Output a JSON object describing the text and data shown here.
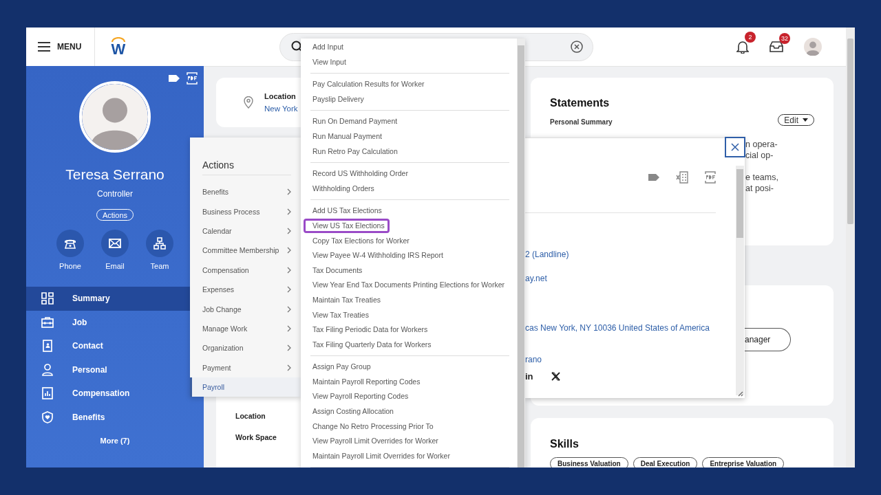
{
  "top_bar": {
    "menu_label": "MENU",
    "logo": "W",
    "notifications": {
      "count": "2"
    },
    "inbox": {
      "count": "32"
    }
  },
  "profile": {
    "name": "Teresa Serrano",
    "title": "Controller",
    "actions_button": "Actions",
    "quick_actions": [
      {
        "kind": "phone",
        "label": "Phone"
      },
      {
        "kind": "email",
        "label": "Email"
      },
      {
        "kind": "team",
        "label": "Team"
      }
    ]
  },
  "nav": {
    "items": [
      {
        "kind": "summary",
        "label": "Summary",
        "selected": true
      },
      {
        "kind": "job",
        "label": "Job",
        "selected": false
      },
      {
        "kind": "contact",
        "label": "Contact",
        "selected": false
      },
      {
        "kind": "personal",
        "label": "Personal",
        "selected": false
      },
      {
        "kind": "compensation",
        "label": "Compensation",
        "selected": false
      },
      {
        "kind": "benefits",
        "label": "Benefits",
        "selected": false
      }
    ],
    "more": "More (7)"
  },
  "location_card": {
    "label": "Location",
    "value": "New York"
  },
  "job_card": {
    "labels": [
      "Location",
      "Work Space"
    ]
  },
  "statements": {
    "title": "Statements",
    "subtitle": "Personal Summary",
    "edit_button": "Edit",
    "paragraphs": [
      [
        "n opera-",
        "cial op-"
      ],
      [
        "e teams,",
        "at posi-"
      ]
    ]
  },
  "manager_card": {
    "button": "anager"
  },
  "skills": {
    "title": "Skills",
    "chips": [
      "Business Valuation",
      "Deal Execution",
      "Entreprise Valuation"
    ]
  },
  "contact_popup": {
    "phone": "2 (Landline)",
    "email": "ay.net",
    "address": "cas New York, NY 10036 United States of America",
    "name": "rano",
    "social": [
      {
        "kind": "linkedin",
        "label": "in"
      },
      {
        "kind": "x"
      }
    ]
  },
  "actions_menu": {
    "title": "Actions",
    "items": [
      {
        "label": "Benefits",
        "selected": false
      },
      {
        "label": "Business Process",
        "selected": false
      },
      {
        "label": "Calendar",
        "selected": false
      },
      {
        "label": "Committee Membership",
        "selected": false
      },
      {
        "label": "Compensation",
        "selected": false
      },
      {
        "label": "Expenses",
        "selected": false
      },
      {
        "label": "Job Change",
        "selected": false
      },
      {
        "label": "Manage Work",
        "selected": false
      },
      {
        "label": "Organization",
        "selected": false
      },
      {
        "label": "Payment",
        "selected": false
      },
      {
        "label": "Payroll",
        "selected": true
      }
    ]
  },
  "payroll_submenu": {
    "groups": [
      [
        {
          "label": "Add Input",
          "highlighted": false
        },
        {
          "label": "View Input",
          "highlighted": false
        }
      ],
      [
        {
          "label": "Pay Calculation Results for Worker",
          "highlighted": false
        },
        {
          "label": "Payslip Delivery",
          "highlighted": false
        }
      ],
      [
        {
          "label": "Run On Demand Payment",
          "highlighted": false
        },
        {
          "label": "Run Manual Payment",
          "highlighted": false
        },
        {
          "label": "Run Retro Pay Calculation",
          "highlighted": false
        }
      ],
      [
        {
          "label": "Record US Withholding Order",
          "highlighted": false
        },
        {
          "label": "Withholding Orders",
          "highlighted": false
        }
      ],
      [
        {
          "label": "Add US Tax Elections",
          "highlighted": false
        },
        {
          "label": "View US Tax Elections",
          "highlighted": true
        },
        {
          "label": "Copy Tax Elections for Worker",
          "highlighted": false
        },
        {
          "label": "View Payee W-4 Withholding IRS Report",
          "highlighted": false
        },
        {
          "label": "Tax Documents",
          "highlighted": false
        },
        {
          "label": "View Year End Tax Documents Printing Elections for Worker",
          "highlighted": false
        },
        {
          "label": "Maintain Tax Treaties",
          "highlighted": false
        },
        {
          "label": "View Tax Treaties",
          "highlighted": false
        },
        {
          "label": "Tax Filing Periodic Data for Workers",
          "highlighted": false
        },
        {
          "label": "Tax Filing Quarterly Data for Workers",
          "highlighted": false
        }
      ],
      [
        {
          "label": "Assign Pay Group",
          "highlighted": false
        },
        {
          "label": "Maintain Payroll Reporting Codes",
          "highlighted": false
        },
        {
          "label": "View Payroll Reporting Codes",
          "highlighted": false
        },
        {
          "label": "Assign Costing Allocation",
          "highlighted": false
        },
        {
          "label": "Change No Retro Processing Prior To",
          "highlighted": false
        },
        {
          "label": "View Payroll Limit Overrides for Worker",
          "highlighted": false
        },
        {
          "label": "Maintain Payroll Limit Overrides for Worker",
          "highlighted": false
        }
      ]
    ]
  }
}
